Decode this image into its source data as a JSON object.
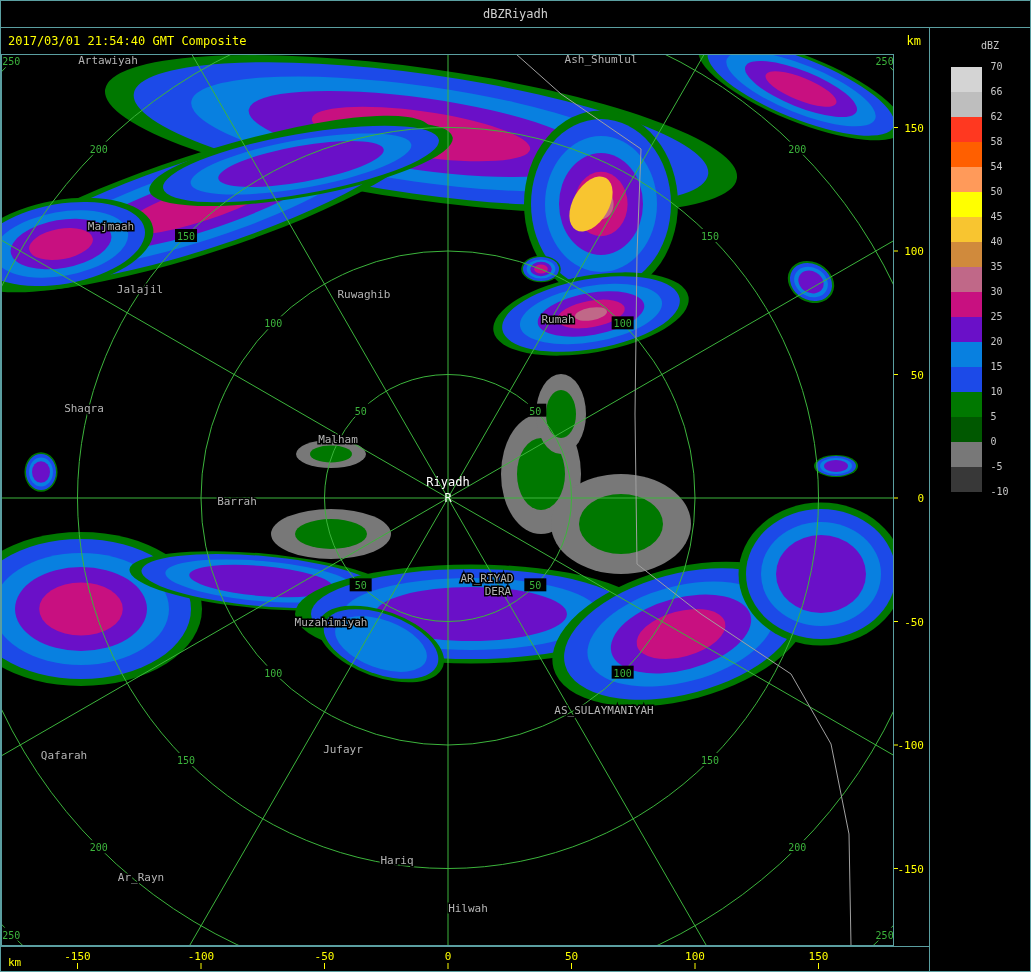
{
  "window": {
    "title": "dBZRiyadh"
  },
  "header": {
    "timestamp": "2017/03/01 21:54:40 GMT Composite",
    "unit": "km"
  },
  "map": {
    "radar_name": "Riyadh",
    "radar_marker": "R",
    "places": [
      {
        "name": "Artawiyah"
      },
      {
        "name": "Ash_Shumlul"
      },
      {
        "name": "Majmaah"
      },
      {
        "name": "Jalajil"
      },
      {
        "name": "Ruwaghib"
      },
      {
        "name": "Rumah"
      },
      {
        "name": "Shaqra"
      },
      {
        "name": "Malham"
      },
      {
        "name": "Barrah"
      },
      {
        "name": "AR_RIYAD"
      },
      {
        "name": "DERA"
      },
      {
        "name": "Muzahimiyah"
      },
      {
        "name": "AS_SULAYMANIYAH"
      },
      {
        "name": "Qafarah"
      },
      {
        "name": "Jufayr"
      },
      {
        "name": "Hariq"
      },
      {
        "name": "Ar_Rayn"
      },
      {
        "name": "Hilwah"
      }
    ],
    "ring_labels": [
      [
        "50",
        "50",
        "50",
        "50"
      ],
      [
        "100",
        "100",
        "100",
        "100"
      ],
      [
        "150",
        "150",
        "150",
        "150"
      ],
      [
        "200",
        "200",
        "200",
        "200"
      ],
      [
        "250",
        "250",
        "250",
        "250"
      ]
    ]
  },
  "y_axis": {
    "ticks": [
      "150",
      "100",
      "50",
      "0",
      "-50",
      "-100",
      "-150"
    ]
  },
  "x_axis": {
    "unit": "km",
    "ticks": [
      "-150",
      "-100",
      "-50",
      "0",
      "50",
      "100",
      "150"
    ]
  },
  "legend": {
    "title": "dBZ",
    "labels": [
      "70",
      "66",
      "62",
      "58",
      "54",
      "50",
      "45",
      "40",
      "35",
      "30",
      "25",
      "20",
      "15",
      "10",
      "5",
      "0",
      "-5",
      "-10"
    ],
    "bands": [
      {
        "color": "#d4d4d4"
      },
      {
        "color": "#bebebe"
      },
      {
        "color": "#ff3820"
      },
      {
        "color": "#ff5f00"
      },
      {
        "color": "#ff9a5a"
      },
      {
        "color": "#ffff00"
      },
      {
        "color": "#f8c530"
      },
      {
        "color": "#d08a3c"
      },
      {
        "color": "#c06888"
      },
      {
        "color": "#c81080"
      },
      {
        "color": "#6a10c8"
      },
      {
        "color": "#0880e0"
      },
      {
        "color": "#1c4ae8"
      },
      {
        "color": "#007800"
      },
      {
        "color": "#005800"
      },
      {
        "color": "#787878"
      },
      {
        "color": "#383838"
      }
    ]
  }
}
